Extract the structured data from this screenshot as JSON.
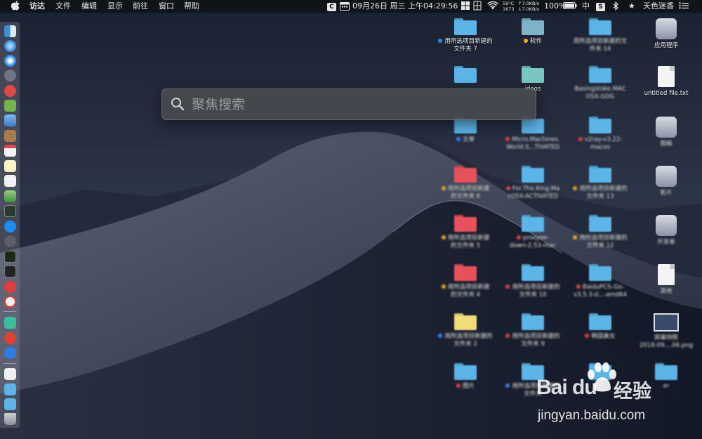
{
  "menubar": {
    "app_menu": [
      "访达",
      "文件",
      "编辑",
      "显示",
      "前往",
      "窗口",
      "帮助"
    ],
    "status": {
      "date_time": "09月26日 周三 上午04:29:56",
      "temp": "59°C",
      "cpu": "1673",
      "net_up": "↑7.0KB/s",
      "net_down": "↓7.0KB/s",
      "battery": "100%",
      "ime": "中",
      "user": "天色迷香"
    }
  },
  "spotlight": {
    "placeholder": "聚焦搜索",
    "value": ""
  },
  "desktop": {
    "items": [
      {
        "label_line1": "用所选项目新建的",
        "label_line2": "文件夹 7",
        "tag_color": "#3b82f6",
        "folder_color": "#5bb5e8",
        "kind": "folder"
      },
      {
        "label_line1": "软件",
        "label_line2": "",
        "tag_color": "#f5a623",
        "folder_color": "#7fb3c9",
        "kind": "folder"
      },
      {
        "label_line1": "周所选项目新建的文",
        "label_line2": "件夹 14",
        "tag_color": "",
        "folder_color": "#5bb5e8",
        "kind": "folder"
      },
      {
        "label_line1": "应用程序",
        "label_line2": "",
        "tag_color": "",
        "folder_color": "",
        "kind": "app"
      },
      {
        "label_line1": "",
        "label_line2": "",
        "tag_color": "",
        "folder_color": "#5bb5e8",
        "kind": "folder"
      },
      {
        "label_line1": "ideos",
        "label_line2": "",
        "tag_color": "",
        "folder_color": "#79c7c2",
        "kind": "folder"
      },
      {
        "label_line1": "Basingstoke.MAC",
        "label_line2": "OSX-GOG",
        "tag_color": "",
        "folder_color": "#5bb5e8",
        "kind": "folder"
      },
      {
        "label_line1": "untitled file.txt",
        "label_line2": "",
        "tag_color": "",
        "folder_color": "",
        "kind": "doc"
      },
      {
        "label_line1": "文章",
        "label_line2": "",
        "tag_color": "#3b82f6",
        "folder_color": "#5bb5e8",
        "kind": "folder"
      },
      {
        "label_line1": "Micro.Machines.",
        "label_line2": "World.S...TIVATED",
        "tag_color": "#e04545",
        "folder_color": "#5bb5e8",
        "kind": "folder"
      },
      {
        "label_line1": "v2ray-v3.22-",
        "label_line2": "macos",
        "tag_color": "#e04545",
        "folder_color": "#5bb5e8",
        "kind": "folder"
      },
      {
        "label_line1": "图稿",
        "label_line2": "",
        "tag_color": "",
        "folder_color": "",
        "kind": "app"
      },
      {
        "label_line1": "用所选项目新建",
        "label_line2": "的文件夹 6",
        "tag_color": "#f5a623",
        "folder_color": "#e8505b",
        "kind": "folder"
      },
      {
        "label_line1": "For.The.King.Ma",
        "label_line2": "cOSX-ACTIVATED",
        "tag_color": "#e04545",
        "folder_color": "#5bb5e8",
        "kind": "folder"
      },
      {
        "label_line1": "用所选项目新建的",
        "label_line2": "文件夹 13",
        "tag_color": "#f5a623",
        "folder_color": "#5bb5e8",
        "kind": "folder"
      },
      {
        "label_line1": "影片",
        "label_line2": "",
        "tag_color": "",
        "folder_color": "",
        "kind": "app"
      },
      {
        "label_line1": "用所选项目新建",
        "label_line2": "的文件夹 5",
        "tag_color": "#f5a623",
        "folder_color": "#e8505b",
        "kind": "folder"
      },
      {
        "label_line1": "proxyee-",
        "label_line2": "down-2.53-mac",
        "tag_color": "#e04545",
        "folder_color": "#5bb5e8",
        "kind": "folder"
      },
      {
        "label_line1": "用所选项目新建的",
        "label_line2": "文件夹 12",
        "tag_color": "#f5a623",
        "folder_color": "#5bb5e8",
        "kind": "folder"
      },
      {
        "label_line1": "开发者",
        "label_line2": "",
        "tag_color": "",
        "folder_color": "",
        "kind": "app"
      },
      {
        "label_line1": "用所选项目新建",
        "label_line2": "的文件夹 4",
        "tag_color": "#f5a623",
        "folder_color": "#e8505b",
        "kind": "folder"
      },
      {
        "label_line1": "用所选项目新建的",
        "label_line2": "文件夹 10",
        "tag_color": "#e04545",
        "folder_color": "#5bb5e8",
        "kind": "folder"
      },
      {
        "label_line1": "BaiduPCS-Go-",
        "label_line2": "v3.5.3-d...-amd64",
        "tag_color": "#e04545",
        "folder_color": "#5bb5e8",
        "kind": "folder"
      },
      {
        "label_line1": "其他",
        "label_line2": "",
        "tag_color": "",
        "folder_color": "",
        "kind": "doc"
      },
      {
        "label_line1": "用所选项目新建的",
        "label_line2": "文件夹 2",
        "tag_color": "#3b82f6",
        "folder_color": "#f2dc7a",
        "kind": "folder"
      },
      {
        "label_line1": "用所选项目新建的",
        "label_line2": "文件夹 9",
        "tag_color": "#e04545",
        "folder_color": "#5bb5e8",
        "kind": "folder"
      },
      {
        "label_line1": "韩国美女",
        "label_line2": "",
        "tag_color": "#e04545",
        "folder_color": "#5bb5e8",
        "kind": "folder"
      },
      {
        "label_line1": "屏幕快照",
        "label_line2": "2018-09....06.png",
        "tag_color": "",
        "folder_color": "",
        "kind": "image"
      },
      {
        "label_line1": "图片",
        "label_line2": "",
        "tag_color": "#e04545",
        "folder_color": "#5bb5e8",
        "kind": "folder"
      },
      {
        "label_line1": "用所选项目新建的",
        "label_line2": "文件夹",
        "tag_color": "#3b82f6",
        "folder_color": "#5bb5e8",
        "kind": "folder"
      },
      {
        "label_line1": "",
        "label_line2": "",
        "tag_color": "",
        "folder_color": "#5bb5e8",
        "kind": "folder"
      },
      {
        "label_line1": "er",
        "label_line2": "",
        "tag_color": "",
        "folder_color": "#5bb5e8",
        "kind": "folder"
      }
    ]
  },
  "watermark": {
    "brand": "Bai du",
    "cn": "经验",
    "url": "jingyan.baidu.com"
  }
}
